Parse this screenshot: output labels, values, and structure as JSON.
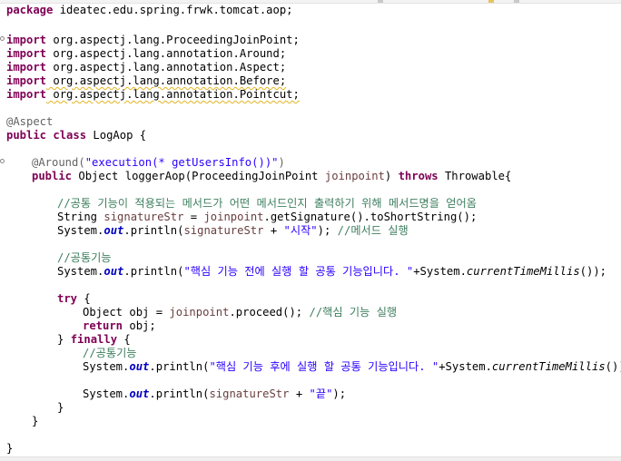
{
  "editor": {
    "package_kw": "package",
    "package_name": " ideatec.edu.spring.frwk.tomcat.aop;",
    "import_kw": "import",
    "imports": [
      " org.aspectj.lang.ProceedingJoinPoint;",
      " org.aspectj.lang.annotation.Around;",
      " org.aspectj.lang.annotation.Aspect;",
      " org.aspectj.lang.annotation.Before;",
      " org.aspectj.lang.annotation.Pointcut;"
    ],
    "aspect_annotation": "@Aspect",
    "public_kw": "public",
    "class_kw": "class",
    "class_decl": " LogAop {",
    "around_annotation": "@Around(",
    "around_value": "\"execution(* getUsersInfo())\"",
    "around_close": ")",
    "method_sig_a": " Object loggerAop(ProceedingJoinPoint ",
    "param_name": "joinpoint",
    "method_sig_b": ") ",
    "throws_kw": "throws",
    "method_sig_c": " Throwable{",
    "comment_1": "//공통 기능이 적용되는 메서드가 어떤 메서드인지 출력하기 위해 메서드명을 얻어옴",
    "sig_line_a": "String ",
    "sig_var": "signatureStr",
    "sig_line_b": " = ",
    "sig_line_c": ".getSignature().toShortString();",
    "print_a": "System.",
    "out_field": "out",
    "println_call": ".println(",
    "plus": " + ",
    "str_start": "\"시작\"",
    "print_close_semicolon": ");",
    "comment_method_run": " //메서드 실행",
    "comment_common": "//공통기능",
    "str_before": "\"핵심 기능 전에 실행 할 공통 기능입니다. \"",
    "plus_system": "+System.",
    "current_time": "currentTimeMillis",
    "call_close": "());",
    "try_kw": "try",
    "brace_open": " {",
    "obj_line_a": "Object obj = ",
    "obj_line_b": ".proceed();",
    "comment_core_run": " //핵심 기능 실행",
    "return_kw": "return",
    "return_value": " obj;",
    "close_brace": "}",
    "finally_prefix": "} ",
    "finally_kw": "finally",
    "str_after": "\"핵심 기능 후에 실행 할 공통 기능입니다. \"",
    "str_end": "\"끝\""
  },
  "colors": {
    "keyword": "#7f0055",
    "annotation": "#646464",
    "string": "#2a00ff",
    "comment": "#3f7f5f",
    "field": "#0000c0",
    "parameter": "#6a3e3e",
    "warning_underline": "#e6b422"
  }
}
